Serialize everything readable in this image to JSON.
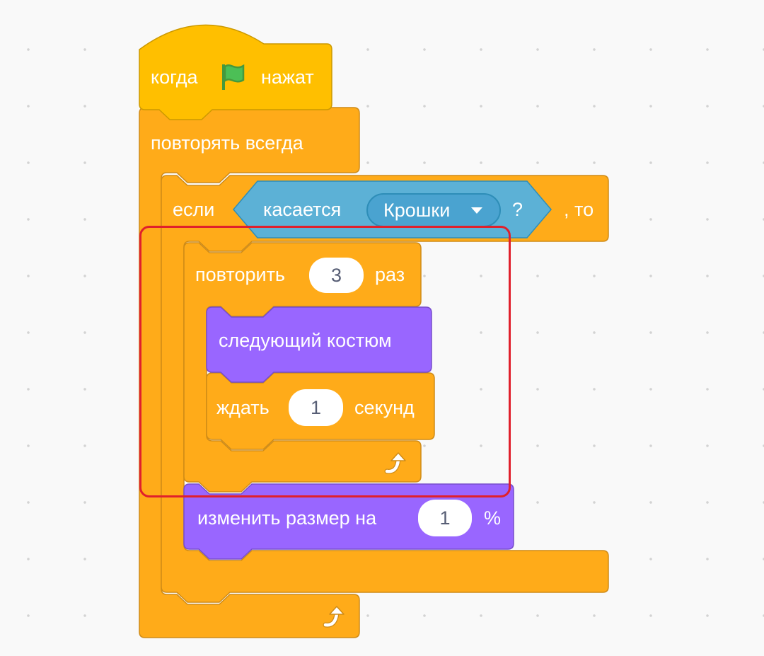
{
  "script": {
    "hat": {
      "label_before": "когда",
      "label_after": "нажат",
      "icon": "green-flag-icon"
    },
    "forever": {
      "label": "повторять всегда",
      "icon": "loop-arrow-icon"
    },
    "if_block": {
      "label_if": "если",
      "label_then": ", то",
      "condition": {
        "label": "касается",
        "option": "Крошки",
        "suffix": "?"
      }
    },
    "repeat": {
      "label_before": "повторить",
      "count": "3",
      "label_after": "раз",
      "icon": "loop-arrow-icon"
    },
    "next_costume": {
      "label": "следующий костюм"
    },
    "wait": {
      "label_before": "ждать",
      "value": "1",
      "label_after": "секунд"
    },
    "change_size": {
      "label_before": "изменить размер на",
      "value": "1",
      "label_after": "%"
    }
  },
  "colors": {
    "control": "#ffab19",
    "control_border": "#cf8b17",
    "events": "#ffbf00",
    "looks": "#9966ff",
    "looks_border": "#774dcb",
    "sensing": "#5cb1d6",
    "highlight": "#e0202c"
  }
}
